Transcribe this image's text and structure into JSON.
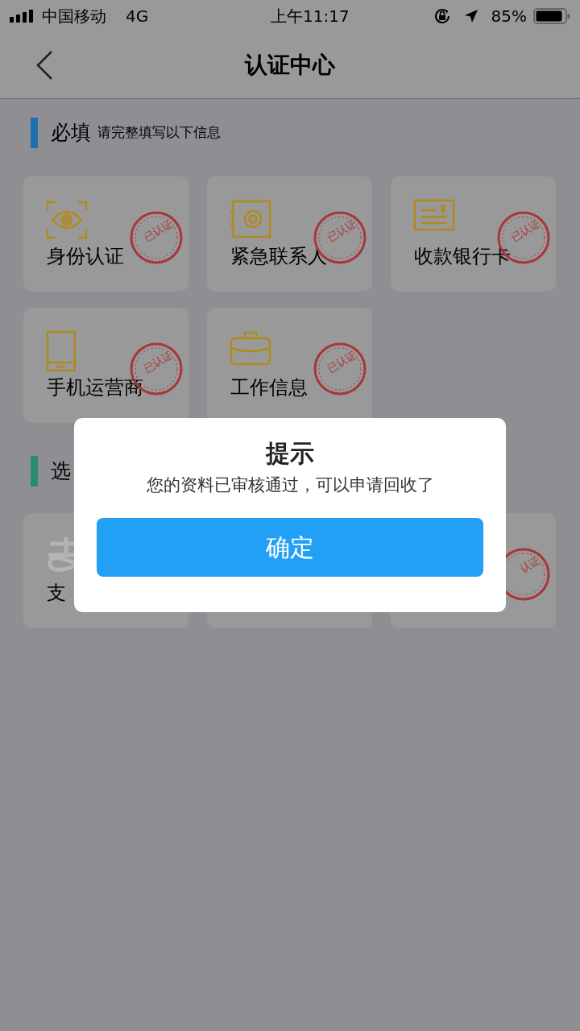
{
  "status_bar": {
    "carrier": "中国移动",
    "network": "4G",
    "time": "上午11:17",
    "battery_text": "85%"
  },
  "nav": {
    "title": "认证中心"
  },
  "sections": [
    {
      "title": "必填",
      "subtitle": "请完整填写以下信息",
      "color": "#1e6fb0",
      "items": [
        {
          "kind": "eye",
          "label": "身份认证",
          "stamp": "已认证"
        },
        {
          "kind": "safe",
          "label": "紧急联系人",
          "stamp": "已认证"
        },
        {
          "kind": "bankcard",
          "label": "收款银行卡",
          "stamp": "已认证"
        },
        {
          "kind": "phone",
          "label": "手机运营商",
          "stamp": "已认证"
        },
        {
          "kind": "briefcase",
          "label": "工作信息",
          "stamp": "已认证"
        }
      ]
    },
    {
      "title": "选",
      "color": "#2e8c6c",
      "items": [
        {
          "kind": "pay",
          "label": "支"
        },
        {
          "kind": "blank"
        },
        {
          "kind": "blank",
          "stamp": "认证"
        }
      ]
    }
  ],
  "dialog": {
    "title": "提示",
    "message": "您的资料已审核通过，可以申请回收了",
    "button": "确定"
  }
}
